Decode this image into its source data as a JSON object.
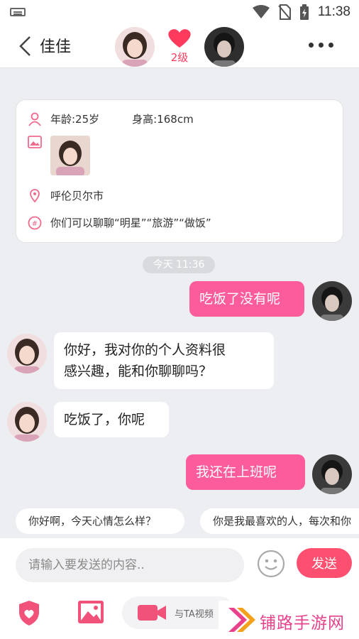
{
  "status_bar": {
    "time": "11:38"
  },
  "header": {
    "title": "佳佳",
    "level": "2级"
  },
  "profile_card": {
    "age": "年龄:25岁",
    "height": "身高:168cm",
    "city": "呼伦贝尔市",
    "topics": "你们可以聊聊“明星”“旅游”“做饭”"
  },
  "timestamp": "今天 11:36",
  "messages": [
    {
      "from": "me",
      "text": "吃饭了没有呢"
    },
    {
      "from": "them",
      "line1": "你好，我对你的个人资料很",
      "line2": "感兴趣，能和你聊聊吗？"
    },
    {
      "from": "them",
      "text": "吃饭了，你呢"
    },
    {
      "from": "me",
      "text": "我还在上班呢"
    }
  ],
  "quick_replies": [
    "你好啊，今天心情怎么样？",
    "你是我最喜欢的人，每次和你"
  ],
  "input": {
    "placeholder": "请输入要发送的内容..",
    "send_label": "发送"
  },
  "toolbar": {
    "video_label": "与TA视频"
  },
  "watermark": {
    "text": "铺路手游网"
  },
  "colors": {
    "accent": "#fd5c9c",
    "send": "#fd5070",
    "heart": "#ff3a5c"
  }
}
